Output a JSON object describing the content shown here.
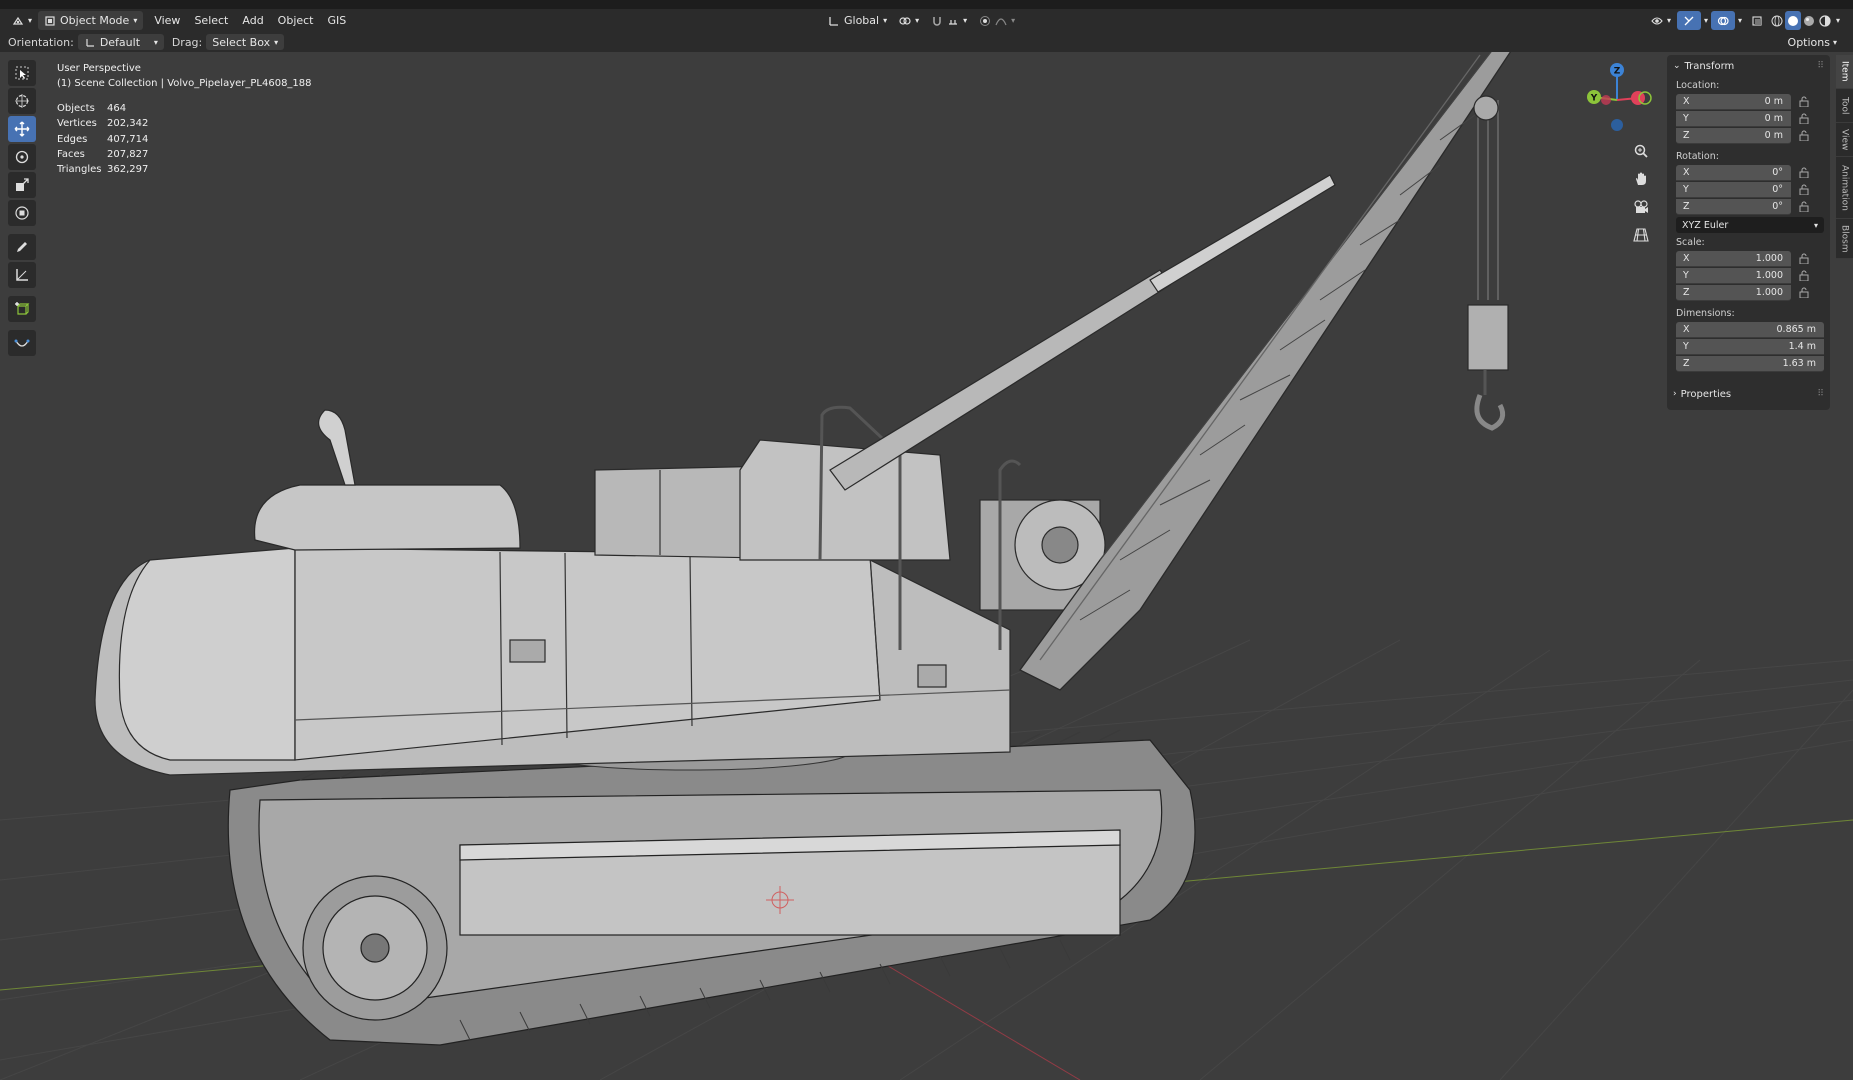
{
  "header": {
    "mode_label": "Object Mode",
    "menus": [
      "View",
      "Select",
      "Add",
      "Object",
      "GIS"
    ],
    "transform_space": "Global"
  },
  "toolbar2": {
    "orientation_label": "Orientation:",
    "orientation_value": "Default",
    "drag_label": "Drag:",
    "drag_value": "Select Box",
    "options_label": "Options"
  },
  "overlay": {
    "perspective": "User Perspective",
    "collection": "(1) Scene Collection | Volvo_Pipelayer_PL4608_188",
    "stats": [
      {
        "label": "Objects",
        "value": "464"
      },
      {
        "label": "Vertices",
        "value": "202,342"
      },
      {
        "label": "Edges",
        "value": "407,714"
      },
      {
        "label": "Faces",
        "value": "207,827"
      },
      {
        "label": "Triangles",
        "value": "362,297"
      }
    ]
  },
  "gizmo": {
    "z": "Z",
    "y": "Y"
  },
  "npanel": {
    "transform_title": "Transform",
    "location_label": "Location:",
    "location": [
      {
        "axis": "X",
        "value": "0 m"
      },
      {
        "axis": "Y",
        "value": "0 m"
      },
      {
        "axis": "Z",
        "value": "0 m"
      }
    ],
    "rotation_label": "Rotation:",
    "rotation": [
      {
        "axis": "X",
        "value": "0°"
      },
      {
        "axis": "Y",
        "value": "0°"
      },
      {
        "axis": "Z",
        "value": "0°"
      }
    ],
    "rotation_mode": "XYZ Euler",
    "scale_label": "Scale:",
    "scale": [
      {
        "axis": "X",
        "value": "1.000"
      },
      {
        "axis": "Y",
        "value": "1.000"
      },
      {
        "axis": "Z",
        "value": "1.000"
      }
    ],
    "dimensions_label": "Dimensions:",
    "dimensions": [
      {
        "axis": "X",
        "value": "0.865 m"
      },
      {
        "axis": "Y",
        "value": "1.4 m"
      },
      {
        "axis": "Z",
        "value": "1.63 m"
      }
    ],
    "properties_title": "Properties"
  },
  "sidetabs": [
    "Item",
    "Tool",
    "View",
    "Animation",
    "Blosm"
  ],
  "colors": {
    "accent": "#4772b3",
    "axis_x": "#e0415a",
    "axis_y": "#8cc43a",
    "axis_z": "#3c83d6"
  }
}
